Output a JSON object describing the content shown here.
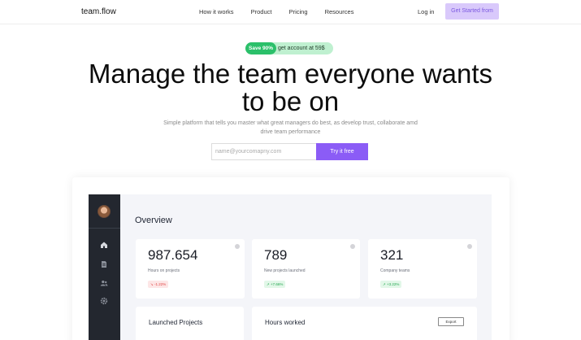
{
  "nav": {
    "brand": "team.flow",
    "links": [
      "How it works",
      "Product",
      "Pricing",
      "Resources"
    ],
    "login": "Log in",
    "cta": "Get Started from"
  },
  "hero": {
    "promo_badge": "Save 90%",
    "promo_text": "get account at 59$",
    "headline": "Manage the team everyone wants to be on",
    "subtitle": "Simple platform that tells you master what great managers do best, as develop trust, collaborate amd drive team performance",
    "email_placeholder": "name@yourcomapny.com",
    "try_label": "Try it free"
  },
  "dashboard": {
    "title": "Overview",
    "sidebar_icons": [
      "home-icon",
      "document-icon",
      "users-icon",
      "settings-icon"
    ],
    "stats": [
      {
        "value": "987.654",
        "label": "Hours on projects",
        "change": "↘ -1.22%",
        "trend": "down"
      },
      {
        "value": "789",
        "label": "New projects launched",
        "change": "↗ +7.66%",
        "trend": "up"
      },
      {
        "value": "321",
        "label": "Company teams",
        "change": "↗ +3.22%",
        "trend": "up"
      }
    ],
    "panels": {
      "launched_title": "Launched Projects",
      "hours_title": "Hours worked",
      "export_label": "Export"
    }
  },
  "colors": {
    "accent": "#8b5cf6",
    "cta_bg": "#d9c9fb",
    "promo_green": "#2bc06a",
    "sidebar_bg": "#23272f"
  }
}
